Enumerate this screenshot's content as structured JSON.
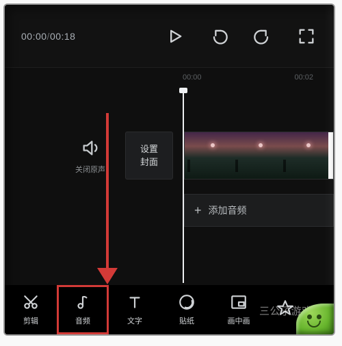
{
  "timecode": {
    "current": "00:00",
    "total": "00:18"
  },
  "ruler": {
    "start": "00:00",
    "end": "00:02"
  },
  "mute": {
    "label": "关闭原声"
  },
  "cover": {
    "line1": "设置",
    "line2": "封面"
  },
  "addAudio": {
    "label": "添加音频"
  },
  "toolbar": {
    "items": [
      {
        "label": "剪辑"
      },
      {
        "label": "音频"
      },
      {
        "label": "文字"
      },
      {
        "label": "贴纸"
      },
      {
        "label": "画中画"
      },
      {
        "label": ""
      }
    ],
    "highlightIndex": 1
  },
  "watermark": "三公子游戏网"
}
